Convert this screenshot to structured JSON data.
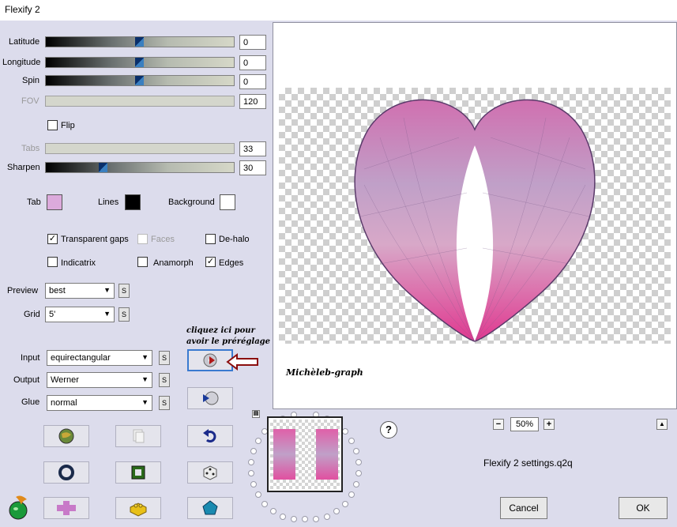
{
  "window": {
    "title": "Flexify 2"
  },
  "sliders": {
    "latitude": {
      "label": "Latitude",
      "value": "0"
    },
    "longitude": {
      "label": "Longitude",
      "value": "0"
    },
    "spin": {
      "label": "Spin",
      "value": "0"
    },
    "fov": {
      "label": "FOV",
      "value": "120"
    },
    "tabs": {
      "label": "Tabs",
      "value": "33"
    },
    "sharpen": {
      "label": "Sharpen",
      "value": "30"
    }
  },
  "flip": {
    "label": "Flip",
    "checked": false
  },
  "colors": {
    "tab": {
      "label": "Tab",
      "color": "#dcaadc"
    },
    "lines": {
      "label": "Lines",
      "color": "#000000"
    },
    "background": {
      "label": "Background",
      "color": "#ffffff"
    }
  },
  "options": {
    "transparent_gaps": {
      "label": "Transparent gaps",
      "checked": true
    },
    "faces": {
      "label": "Faces",
      "checked": false
    },
    "de_halo": {
      "label": "De-halo",
      "checked": false
    },
    "indicatrix": {
      "label": "Indicatrix",
      "checked": false
    },
    "anamorph": {
      "label": "Anamorph",
      "checked": false
    },
    "edges": {
      "label": "Edges",
      "checked": true
    }
  },
  "dropdowns": {
    "preview": {
      "label": "Preview",
      "value": "best",
      "s": "S"
    },
    "grid": {
      "label": "Grid",
      "value": "5'",
      "s": "S"
    },
    "input": {
      "label": "Input",
      "value": "equirectangular",
      "s": "S"
    },
    "output": {
      "label": "Output",
      "value": "Werner",
      "s": "S"
    },
    "glue": {
      "label": "Glue",
      "value": "normal",
      "s": "S"
    }
  },
  "annotation": {
    "line1": "cliquez ici pour",
    "line2": "avoir le préréglage"
  },
  "preview": {
    "signature": "Michèleb-graph"
  },
  "zoom": {
    "minus": "−",
    "value": "50%",
    "plus": "+"
  },
  "help": "?",
  "collapse": "▲",
  "settings_file": "Flexify 2 settings.q2q",
  "buttons": {
    "cancel": "Cancel",
    "ok": "OK"
  }
}
